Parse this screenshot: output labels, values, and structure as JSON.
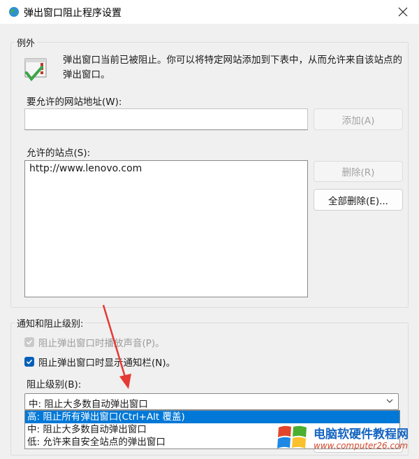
{
  "window": {
    "title": "弹出窗口阻止程序设置",
    "close_glyph": "✕"
  },
  "exceptions": {
    "group_label": "例外",
    "description": "弹出窗口当前已被阻止。你可以将特定网站添加到下表中，从而允许来自该站点的弹出窗口。",
    "address_label": "要允许的网站地址(W):",
    "address_value": "",
    "add_button": "添加(A)",
    "allowed_label": "允许的站点(S):",
    "allowed_sites": [
      "http://www.lenovo.com"
    ],
    "remove_button": "删除(R)",
    "remove_all_button": "全部删除(E)..."
  },
  "notifications": {
    "group_label": "通知和阻止级别:",
    "play_sound_label": "阻止弹出窗口时播放声音(P)。",
    "play_sound_checked": true,
    "show_bar_label": "阻止弹出窗口时显示通知栏(N)。",
    "show_bar_checked": true,
    "blocking_level_label": "阻止级别(B):",
    "blocking_level_selected": "中: 阻止大多数自动弹出窗口",
    "blocking_level_options": [
      "高: 阻止所有弹出窗口(Ctrl+Alt 覆盖)",
      "中: 阻止大多数自动弹出窗口",
      "低: 允许来自安全站点的弹出窗口"
    ],
    "highlighted_option_index": 0
  },
  "watermark": {
    "title": "电脑软硬件教程网",
    "url": "www.computer26.com"
  },
  "colors": {
    "accent": "#005fb8",
    "highlight": "#0078d7",
    "arrow": "#e53935"
  }
}
